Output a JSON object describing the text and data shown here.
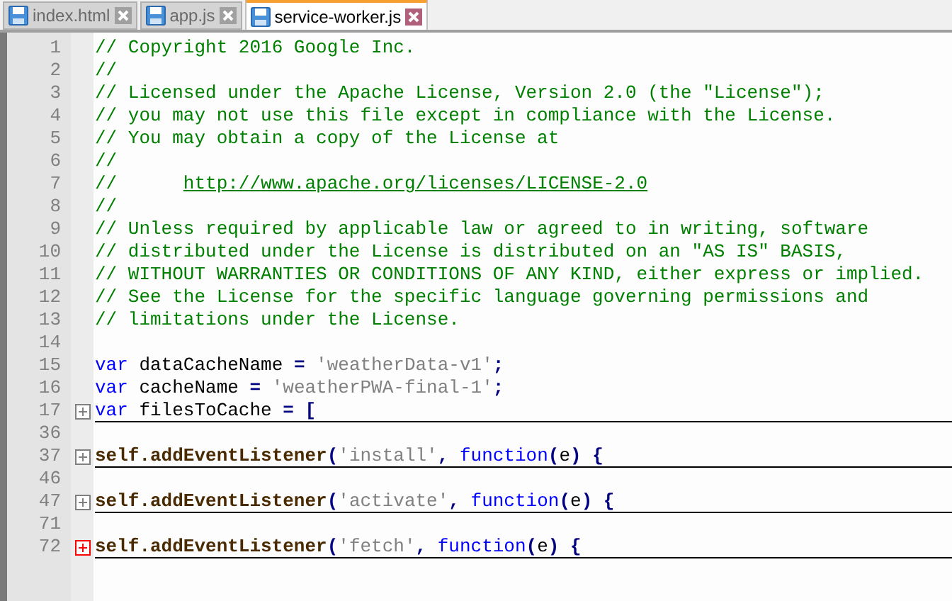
{
  "tabs": [
    {
      "label": "index.html",
      "selected": false
    },
    {
      "label": "app.js",
      "selected": false
    },
    {
      "label": "service-worker.js",
      "selected": true
    }
  ],
  "lines": [
    {
      "number": "1",
      "tokens": [
        {
          "kind": "comment",
          "text": "// Copyright 2016 Google Inc."
        }
      ]
    },
    {
      "number": "2",
      "tokens": [
        {
          "kind": "comment",
          "text": "//"
        }
      ]
    },
    {
      "number": "3",
      "tokens": [
        {
          "kind": "comment",
          "text": "// Licensed under the Apache License, Version 2.0 (the \"License\");"
        }
      ]
    },
    {
      "number": "4",
      "tokens": [
        {
          "kind": "comment",
          "text": "// you may not use this file except in compliance with the License."
        }
      ]
    },
    {
      "number": "5",
      "tokens": [
        {
          "kind": "comment",
          "text": "// You may obtain a copy of the License at"
        }
      ]
    },
    {
      "number": "6",
      "tokens": [
        {
          "kind": "comment",
          "text": "//"
        }
      ]
    },
    {
      "number": "7",
      "tokens": [
        {
          "kind": "comment",
          "text": "//      "
        },
        {
          "kind": "url",
          "text": "http://www.apache.org/licenses/LICENSE-2.0"
        }
      ]
    },
    {
      "number": "8",
      "tokens": [
        {
          "kind": "comment",
          "text": "//"
        }
      ]
    },
    {
      "number": "9",
      "tokens": [
        {
          "kind": "comment",
          "text": "// Unless required by applicable law or agreed to in writing, software"
        }
      ]
    },
    {
      "number": "10",
      "tokens": [
        {
          "kind": "comment",
          "text": "// distributed under the License is distributed on an \"AS IS\" BASIS,"
        }
      ]
    },
    {
      "number": "11",
      "tokens": [
        {
          "kind": "comment",
          "text": "// WITHOUT WARRANTIES OR CONDITIONS OF ANY KIND, either express or implied."
        }
      ]
    },
    {
      "number": "12",
      "tokens": [
        {
          "kind": "comment",
          "text": "// See the License for the specific language governing permissions and"
        }
      ]
    },
    {
      "number": "13",
      "tokens": [
        {
          "kind": "comment",
          "text": "// limitations under the License."
        }
      ]
    },
    {
      "number": "14"
    },
    {
      "number": "15",
      "tokens": [
        {
          "kind": "keyword",
          "text": "var"
        },
        {
          "kind": "plain",
          "text": " dataCacheName "
        },
        {
          "kind": "operator",
          "text": "= "
        },
        {
          "kind": "string",
          "text": "'weatherData-v1'"
        },
        {
          "kind": "operator",
          "text": ";"
        }
      ]
    },
    {
      "number": "16",
      "tokens": [
        {
          "kind": "keyword",
          "text": "var"
        },
        {
          "kind": "plain",
          "text": " cacheName "
        },
        {
          "kind": "operator",
          "text": "= "
        },
        {
          "kind": "string",
          "text": "'weatherPWA-final-1'"
        },
        {
          "kind": "operator",
          "text": ";"
        }
      ]
    },
    {
      "number": "17",
      "fold": true,
      "marker_active": false,
      "tokens": [
        {
          "kind": "keyword",
          "text": "var"
        },
        {
          "kind": "plain",
          "text": " filesToCache "
        },
        {
          "kind": "operator",
          "text": "= ["
        }
      ]
    },
    {
      "number": "36"
    },
    {
      "number": "37",
      "fold": true,
      "marker_active": false,
      "tokens": [
        {
          "kind": "identifier",
          "text": "self.addEventListener"
        },
        {
          "kind": "operator",
          "text": "("
        },
        {
          "kind": "string",
          "text": "'install'"
        },
        {
          "kind": "operator",
          "text": ", "
        },
        {
          "kind": "keyword",
          "text": "function"
        },
        {
          "kind": "operator",
          "text": "("
        },
        {
          "kind": "plain",
          "text": "e"
        },
        {
          "kind": "operator",
          "text": ") {"
        }
      ]
    },
    {
      "number": "46"
    },
    {
      "number": "47",
      "fold": true,
      "marker_active": false,
      "tokens": [
        {
          "kind": "identifier",
          "text": "self.addEventListener"
        },
        {
          "kind": "operator",
          "text": "("
        },
        {
          "kind": "string",
          "text": "'activate'"
        },
        {
          "kind": "operator",
          "text": ", "
        },
        {
          "kind": "keyword",
          "text": "function"
        },
        {
          "kind": "operator",
          "text": "("
        },
        {
          "kind": "plain",
          "text": "e"
        },
        {
          "kind": "operator",
          "text": ") {"
        }
      ]
    },
    {
      "number": "71"
    },
    {
      "number": "72",
      "fold": true,
      "marker_active": true,
      "tokens": [
        {
          "kind": "identifier",
          "text": "self.addEventListener"
        },
        {
          "kind": "operator",
          "text": "("
        },
        {
          "kind": "string",
          "text": "'fetch'"
        },
        {
          "kind": "operator",
          "text": ", "
        },
        {
          "kind": "keyword",
          "text": "function"
        },
        {
          "kind": "operator",
          "text": "("
        },
        {
          "kind": "plain",
          "text": "e"
        },
        {
          "kind": "operator",
          "text": ") {"
        }
      ]
    }
  ]
}
